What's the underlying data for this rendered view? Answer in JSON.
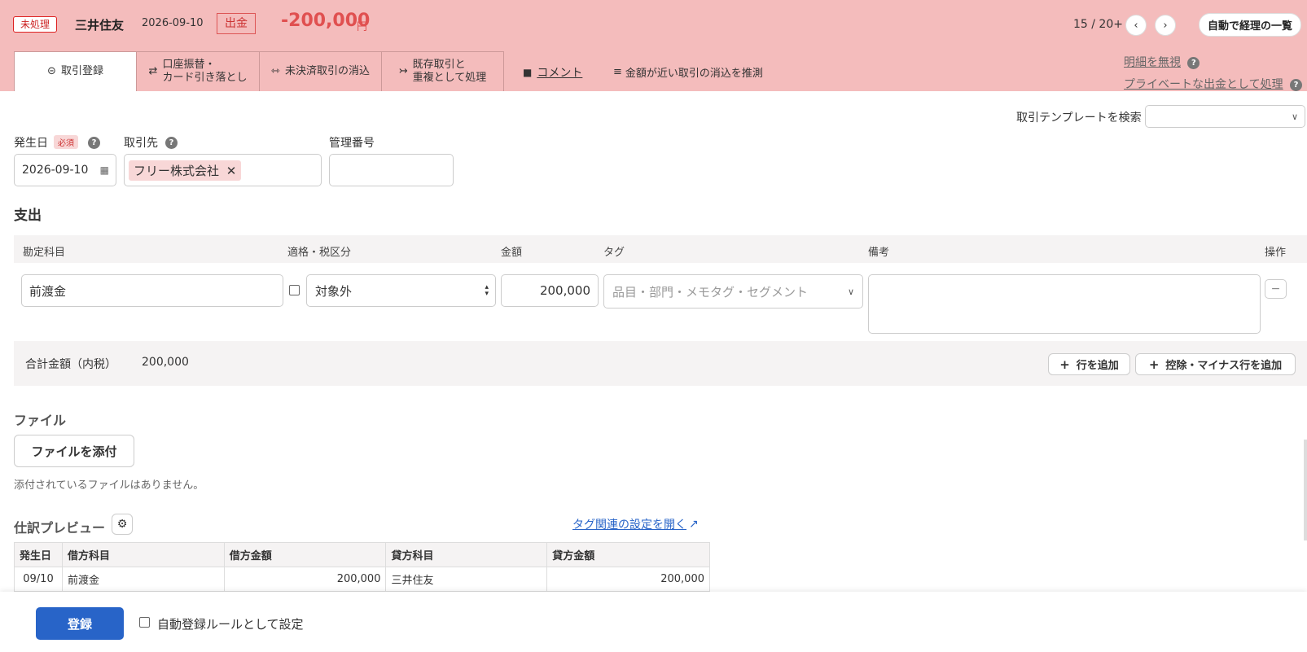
{
  "header": {
    "status": "未処理",
    "bank": "三井住友",
    "date": "2026-09-10",
    "type": "出金",
    "amount": "-200,000",
    "currency": "円",
    "pager": "15 / 20+",
    "auto_list": "自動で経理の一覧",
    "ignore_link": "明細を無視",
    "private_link": "プライベートな出金として処理"
  },
  "tabs": [
    {
      "label": "取引登録"
    },
    {
      "label1": "口座振替・",
      "label2": "カード引き落とし"
    },
    {
      "label": "未決済取引の消込"
    },
    {
      "label1": "既存取引と",
      "label2": "重複として処理"
    }
  ],
  "actions": {
    "comment": "コメント",
    "suggest": "金額が近い取引の消込を推測"
  },
  "template": {
    "label": "取引テンプレートを検索",
    "value": ""
  },
  "form": {
    "date_label": "発生日",
    "required": "必須",
    "date_value": "2026-09-10",
    "partner_label": "取引先",
    "partner_value": "フリー株式会社",
    "mgmt_label": "管理番号",
    "mgmt_value": ""
  },
  "expense": {
    "title": "支出",
    "columns": [
      "勘定科目",
      "適格・税区分",
      "金額",
      "タグ",
      "備考",
      "操作"
    ],
    "row": {
      "account": "前渡金",
      "tax": "対象外",
      "amount": "200,000",
      "tag_placeholder": "品目・部門・メモタグ・セグメント",
      "memo": ""
    },
    "total_label": "合計金額（内税）",
    "total_value": "200,000",
    "add_row": "行を追加",
    "add_minus_row": "控除・マイナス行を追加"
  },
  "file": {
    "title": "ファイル",
    "attach": "ファイルを添付",
    "none": "添付されているファイルはありません。"
  },
  "preview": {
    "title": "仕訳プレビュー",
    "tag_settings_link": "タグ関連の設定を開く",
    "headers": [
      "発生日",
      "借方科目",
      "借方金額",
      "貸方科目",
      "貸方金額"
    ],
    "rows": [
      [
        "09/10",
        "前渡金",
        "200,000",
        "三井住友",
        "200,000"
      ]
    ]
  },
  "footer": {
    "register": "登録",
    "auto_rule": "自動登録ルールとして設定"
  }
}
